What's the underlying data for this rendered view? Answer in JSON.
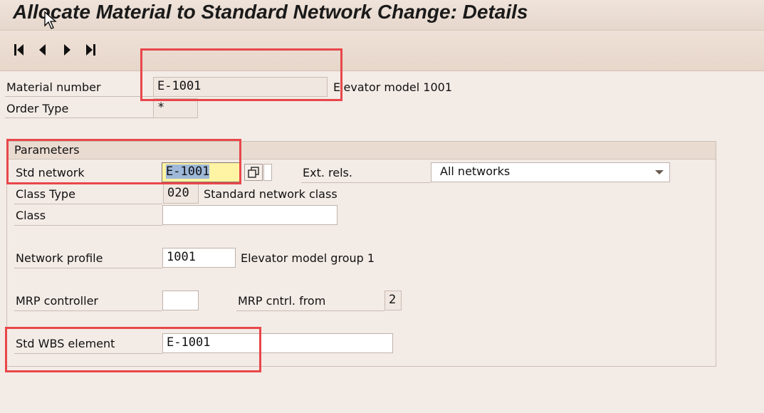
{
  "window": {
    "title": "Allocate Material to Standard Network Change: Details"
  },
  "toolbar": {
    "first_icon": "first-page-icon",
    "prev_icon": "previous-page-icon",
    "next_icon": "next-page-icon",
    "last_icon": "last-page-icon"
  },
  "header": {
    "material_number_label": "Material number",
    "material_number_value": "E-1001",
    "material_description": "Elevator model 1001",
    "order_type_label": "Order Type",
    "order_type_value": "*"
  },
  "parameters": {
    "title": "Parameters",
    "std_network_label": "Std network",
    "std_network_value": "E-1001",
    "ext_rels_label": "Ext. rels.",
    "ext_rels_value": "All networks",
    "class_type_label": "Class Type",
    "class_type_value": "020",
    "class_type_description": "Standard network class",
    "class_label": "Class",
    "class_value": "",
    "network_profile_label": "Network profile",
    "network_profile_value": "1001",
    "network_profile_description": "Elevator model group 1",
    "mrp_controller_label": "MRP controller",
    "mrp_controller_value": "",
    "mrp_cntrl_from_label": "MRP cntrl. from",
    "mrp_cntrl_from_value": "2",
    "std_wbs_label": "Std WBS element",
    "std_wbs_value": "E-1001"
  },
  "colors": {
    "highlight": "#e8474a",
    "selection": "#9fb8d9",
    "focus_field": "#fff4a3"
  }
}
